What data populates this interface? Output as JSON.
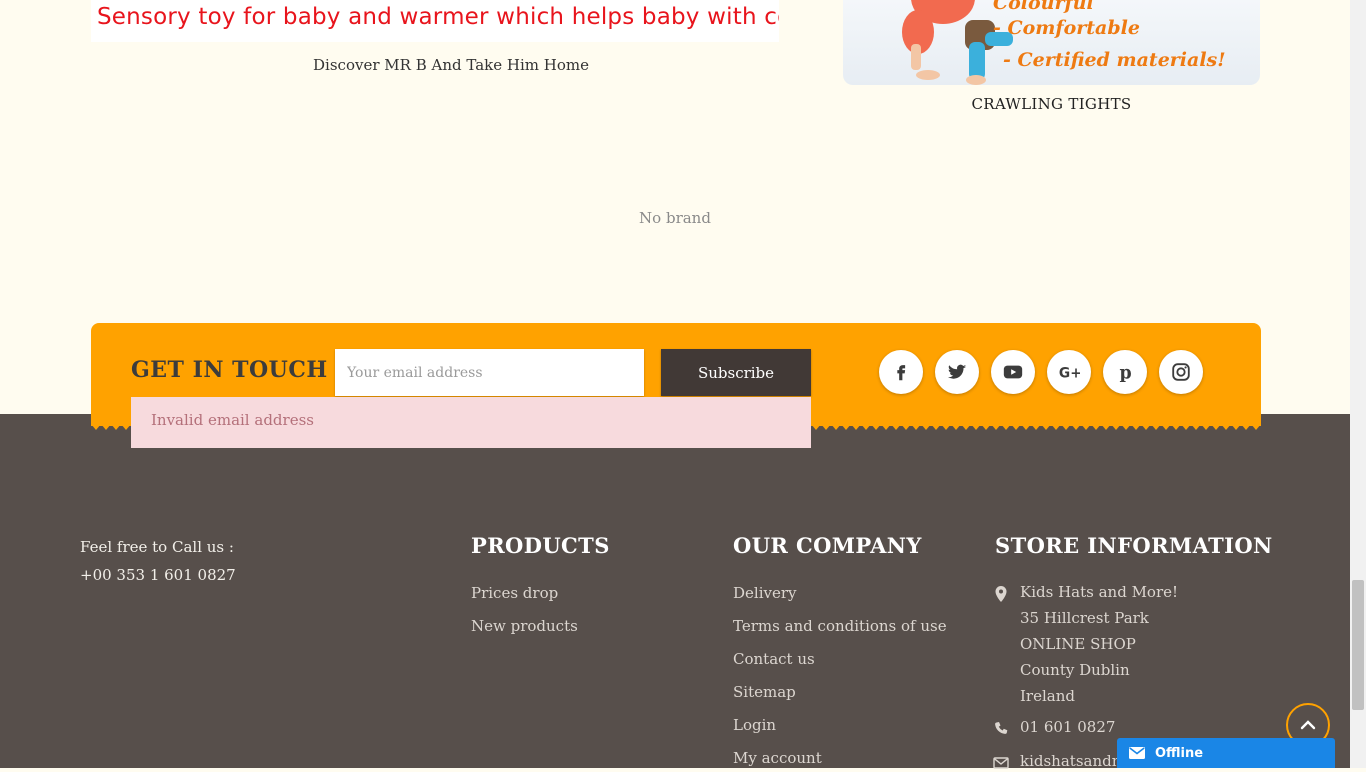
{
  "products": {
    "left": {
      "banner_text": "Sensory toy for baby and  warmer which  helps baby with colic",
      "caption": "Discover MR B And Take Him Home"
    },
    "right": {
      "banner_lines": [
        "Colourful",
        "- Comfortable",
        "- Certified materials!"
      ],
      "caption": "CRAWLING TIGHTS"
    },
    "no_brand": "No brand"
  },
  "newsletter": {
    "title": "GET IN TOUCH",
    "email_placeholder": "Your email address",
    "subscribe_label": "Subscribe",
    "error": "Invalid email address"
  },
  "social": [
    "facebook-icon",
    "twitter-icon",
    "youtube-icon",
    "google-plus-icon",
    "pinterest-icon",
    "instagram-icon"
  ],
  "contact": {
    "label": "Feel free to Call us :",
    "phone": "+00 353 1 601 0827"
  },
  "products_col": {
    "title": "PRODUCTS",
    "links": [
      "Prices drop",
      "New products"
    ]
  },
  "company_col": {
    "title": "OUR COMPANY",
    "links": [
      "Delivery",
      "Terms and conditions of use",
      "Contact us",
      "Sitemap",
      "Login",
      "My account"
    ]
  },
  "store_col": {
    "title": "STORE INFORMATION",
    "address": [
      "Kids Hats and More!",
      "35 Hillcrest Park",
      "ONLINE SHOP",
      "County Dublin",
      "Ireland"
    ],
    "phone": "01 601 0827",
    "email": "kidshatsandm"
  },
  "chat": {
    "status": "Offline"
  },
  "colors": {
    "accent": "#ffa200",
    "footer": "#574f4b",
    "button": "#413936",
    "chat": "#1a86e6"
  }
}
